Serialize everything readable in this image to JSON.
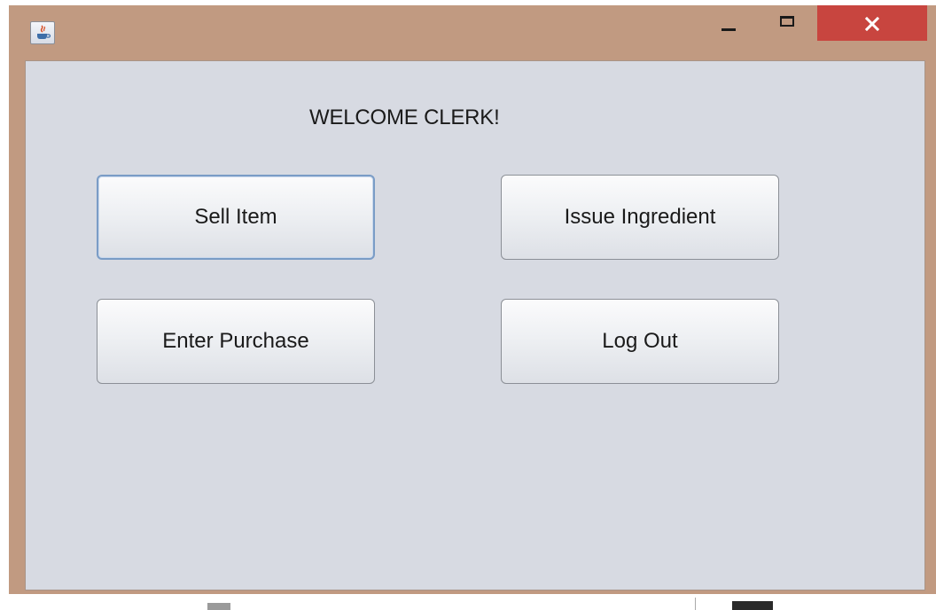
{
  "window": {
    "frame_color": "#c19a81",
    "close_color": "#c8453f",
    "client_bg": "#d7dae2",
    "icons": [
      "java-app-icon",
      "minimize-icon",
      "maximize-icon",
      "close-icon"
    ]
  },
  "main": {
    "welcome_text": "WELCOME CLERK!",
    "buttons": [
      {
        "label": "Sell Item"
      },
      {
        "label": "Issue Ingredient"
      },
      {
        "label": "Enter Purchase"
      },
      {
        "label": "Log Out"
      }
    ]
  }
}
